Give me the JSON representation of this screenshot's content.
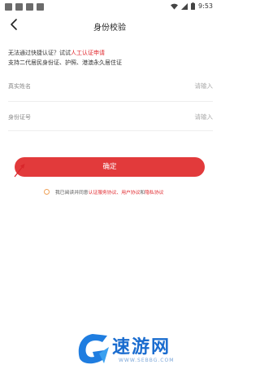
{
  "status_bar": {
    "time": "9:53"
  },
  "nav": {
    "title": "身份校验"
  },
  "notice": {
    "line1_prefix": "无法通过快捷认证？试试",
    "line1_link": "人工认证申请",
    "line2": "支持二代居民身份证、护照、港澳永久居住证"
  },
  "fields": {
    "name": {
      "label": "真实姓名",
      "placeholder": "请输入"
    },
    "id": {
      "label": "身份证号",
      "placeholder": "请输入"
    }
  },
  "confirm_label": "确定",
  "agreement": {
    "prefix": "我已阅读并同意",
    "link1": "认证服务协议",
    "sep": "、",
    "link2": "用户协议",
    "and": "和",
    "link3": "隐私协议"
  },
  "watermark": {
    "text": "速游网",
    "url": "WWW.SEBBG.COM"
  },
  "colors": {
    "accent": "#e23a3b",
    "link": "#e0262b"
  }
}
